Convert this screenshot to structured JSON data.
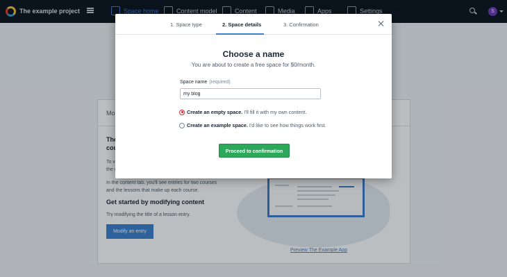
{
  "topbar": {
    "project_name": "The example project",
    "nav": [
      {
        "label": "Space home",
        "icon": "home-icon",
        "active": true
      },
      {
        "label": "Content model",
        "icon": "content-model-icon"
      },
      {
        "label": "Content",
        "icon": "content-icon"
      },
      {
        "label": "Media",
        "icon": "media-icon"
      },
      {
        "label": "Apps",
        "icon": "apps-icon"
      },
      {
        "label": "Settings",
        "icon": "settings-icon"
      }
    ],
    "avatar_initial": "S"
  },
  "background": {
    "card_title": "Mo",
    "heading_partial_1": "The",
    "heading_partial_2": "cou",
    "para_partial_1": "To v",
    "para_partial_2": "the c",
    "para_content_tab": "In the content tab, you'll see entries for two courses and the lessons that make up each course.",
    "get_started": "Get started by modifying content",
    "try_text": "Try modifying the title of a lesson entry.",
    "modify_button": "Modify an entry",
    "preview_link": "Preview The Example App"
  },
  "modal": {
    "steps": [
      {
        "label": "1. Space type",
        "active": false
      },
      {
        "label": "2. Space details",
        "active": true
      },
      {
        "label": "3. Confirmation",
        "active": false
      }
    ],
    "title": "Choose a name",
    "subtitle": "You are about to create a free space for $0/month.",
    "field_label": "Space name",
    "field_required": "(required)",
    "field_value": "my blog",
    "options": [
      {
        "strong": "Create an empty space.",
        "rest": " I'll fill it with my own content.",
        "checked": true
      },
      {
        "strong": "Create an example space.",
        "rest": " I'd like to see how things work first.",
        "checked": false
      }
    ],
    "proceed_label": "Proceed to confirmation"
  }
}
